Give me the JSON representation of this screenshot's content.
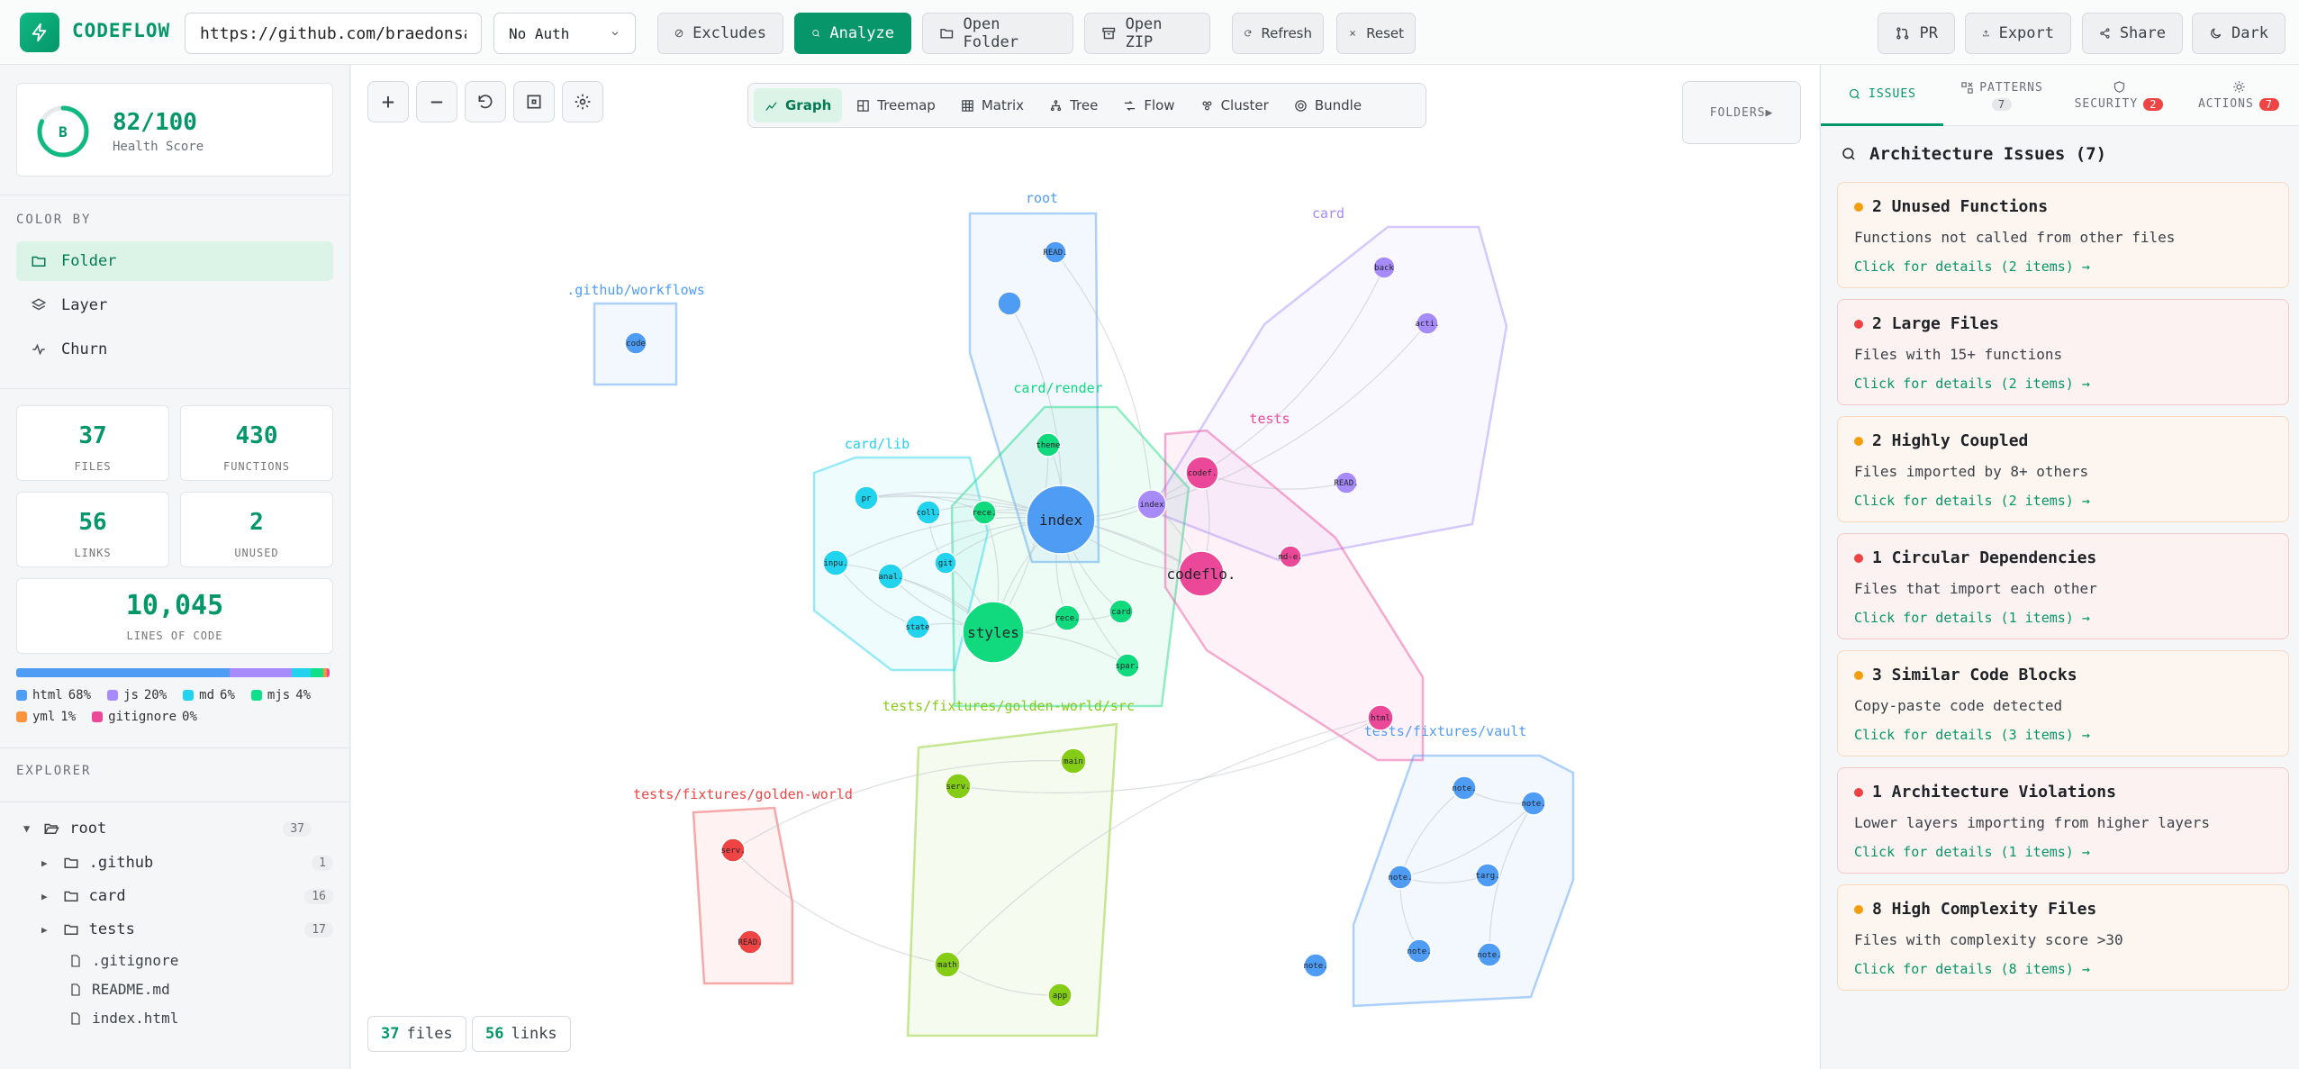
{
  "app": {
    "name": "CODEFLOW"
  },
  "topbar": {
    "url_value": "https://github.com/braedonsaunders/codeflow",
    "auth_value": "No Auth",
    "excludes_label": "Excludes",
    "analyze_label": "Analyze",
    "open_folder_label": "Open Folder",
    "open_zip_label": "Open ZIP",
    "refresh_label": "Refresh",
    "reset_label": "Reset",
    "pr_label": "PR",
    "export_label": "Export",
    "share_label": "Share",
    "theme_label": "Dark"
  },
  "sidebar": {
    "health": {
      "grade": "B",
      "score": "82/100",
      "label": "Health Score",
      "fraction": 0.82
    },
    "color_by_title": "COLOR BY",
    "color_by": [
      {
        "label": "Folder",
        "icon": "folder-icon",
        "active": true
      },
      {
        "label": "Layer",
        "icon": "layers-icon",
        "active": false
      },
      {
        "label": "Churn",
        "icon": "activity-icon",
        "active": false
      }
    ],
    "stats": [
      {
        "value": "37",
        "label": "FILES"
      },
      {
        "value": "430",
        "label": "FUNCTIONS"
      },
      {
        "value": "56",
        "label": "LINKS"
      },
      {
        "value": "2",
        "label": "UNUSED"
      }
    ],
    "loc": {
      "value": "10,045",
      "label": "LINES OF CODE"
    },
    "languages": [
      {
        "name": "html",
        "pct": "68%",
        "share": 0.68,
        "color": "#4f9cf5"
      },
      {
        "name": "js",
        "pct": "20%",
        "share": 0.2,
        "color": "#a78bfa"
      },
      {
        "name": "md",
        "pct": "6%",
        "share": 0.06,
        "color": "#22d3ee"
      },
      {
        "name": "mjs",
        "pct": "4%",
        "share": 0.04,
        "color": "#10e08a"
      },
      {
        "name": "yml",
        "pct": "1%",
        "share": 0.01,
        "color": "#fb923c"
      },
      {
        "name": "gitignore",
        "pct": "0%",
        "share": 0.01,
        "color": "#ec4899"
      }
    ],
    "explorer_title": "EXPLORER",
    "tree": {
      "root": {
        "name": "root",
        "count": "37"
      },
      "folders": [
        {
          "name": ".github",
          "count": "1"
        },
        {
          "name": "card",
          "count": "16"
        },
        {
          "name": "tests",
          "count": "17"
        }
      ],
      "files": [
        ".gitignore",
        "README.md",
        "index.html"
      ]
    }
  },
  "canvas": {
    "view_tabs": [
      {
        "label": "Graph",
        "icon": "graph-icon",
        "active": true
      },
      {
        "label": "Treemap",
        "icon": "treemap-icon",
        "active": false
      },
      {
        "label": "Matrix",
        "icon": "matrix-icon",
        "active": false
      },
      {
        "label": "Tree",
        "icon": "tree-icon",
        "active": false
      },
      {
        "label": "Flow",
        "icon": "flow-icon",
        "active": false
      },
      {
        "label": "Cluster",
        "icon": "cluster-icon",
        "active": false
      },
      {
        "label": "Bundle",
        "icon": "bundle-icon",
        "active": false
      }
    ],
    "folders_toggle": "FOLDERS▶",
    "files_count": "37",
    "files_word": "files",
    "links_count": "56",
    "links_word": "links",
    "groups": [
      {
        "label": ".github/workflows",
        "color": "#4f9cf5"
      },
      {
        "label": "root",
        "color": "#4f9cf5"
      },
      {
        "label": "card",
        "color": "#a78bfa"
      },
      {
        "label": "card/render",
        "color": "#10d97e"
      },
      {
        "label": "card/lib",
        "color": "#22d3ee"
      },
      {
        "label": "tests",
        "color": "#ec4899"
      },
      {
        "label": "tests/fixtures/golden-world/src",
        "color": "#84cc16"
      },
      {
        "label": "tests/fixtures/golden-world",
        "color": "#ef4444"
      },
      {
        "label": "tests/fixtures/vault",
        "color": "#4f9cf5"
      }
    ],
    "node_labels": [
      "code",
      "READ.",
      "back",
      "acti.",
      "READ.",
      "theme",
      "index",
      "index",
      "codef.",
      "pr",
      "coll.",
      "rece.",
      "inpu.",
      "anal.",
      "git",
      "state",
      "styles",
      "rece.",
      "card",
      "spar.",
      "codeflo.",
      "md-e.",
      "html",
      "serv.",
      "main",
      "serv.",
      "READ.",
      "math",
      "app",
      "note.",
      "note.",
      "note.",
      "targ.",
      "note.",
      "note.",
      "note."
    ]
  },
  "right": {
    "tabs": [
      {
        "label": "ISSUES",
        "icon": "search-icon",
        "count": "",
        "active": true
      },
      {
        "label": "PATTERNS",
        "icon": "patterns-icon",
        "count": "7",
        "active": false
      },
      {
        "label": "SECURITY",
        "icon": "shield-icon",
        "count": "2",
        "active": false
      },
      {
        "label": "ACTIONS",
        "icon": "sun-icon",
        "count": "7",
        "active": false
      }
    ],
    "title": "Architecture Issues (7)",
    "issues": [
      {
        "title": "2 Unused Functions",
        "desc": "Functions not called from other files",
        "action": "Click for details (2 items) →",
        "severity": "warning"
      },
      {
        "title": "2 Large Files",
        "desc": "Files with 15+ functions",
        "action": "Click for details (2 items) →",
        "severity": "error"
      },
      {
        "title": "2 Highly Coupled",
        "desc": "Files imported by 8+ others",
        "action": "Click for details (2 items) →",
        "severity": "warning"
      },
      {
        "title": "1 Circular Dependencies",
        "desc": "Files that import each other",
        "action": "Click for details (1 items) →",
        "severity": "error"
      },
      {
        "title": "3 Similar Code Blocks",
        "desc": "Copy-paste code detected",
        "action": "Click for details (3 items) →",
        "severity": "warning"
      },
      {
        "title": "1 Architecture Violations",
        "desc": "Lower layers importing from higher layers",
        "action": "Click for details (1 items) →",
        "severity": "error"
      },
      {
        "title": "8 High Complexity Files",
        "desc": "Files with complexity score >30",
        "action": "Click for details (8 items) →",
        "severity": "warning"
      }
    ]
  }
}
